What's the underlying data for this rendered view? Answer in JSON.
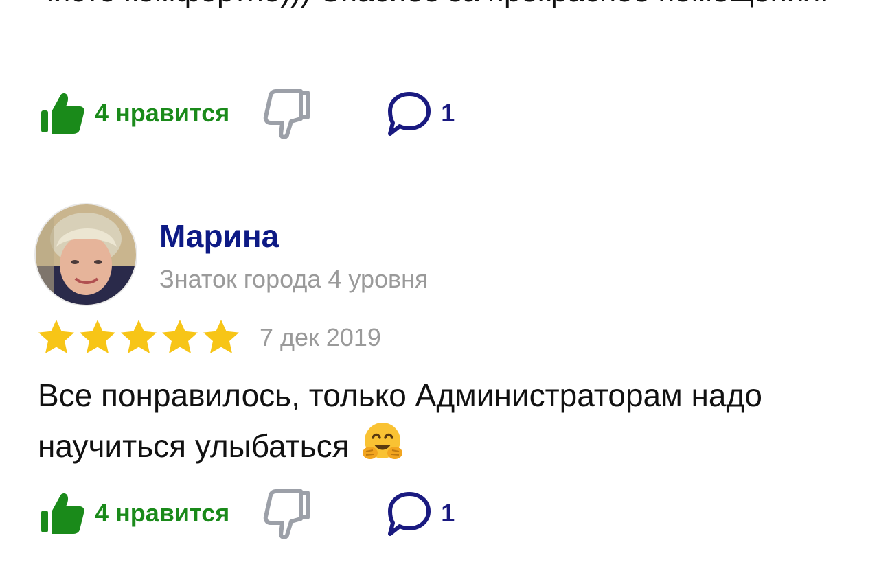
{
  "previous_review": {
    "text": "чисто комфортно))) Спасибо за прекрасное помещения."
  },
  "previous_actions": {
    "likes_label": "4 нравится",
    "comments_count": "1"
  },
  "review": {
    "author_name": "Марина",
    "author_level": "Знаток города 4 уровня",
    "rating": 5,
    "rating_max": 5,
    "date": "7 дек 2019",
    "text": "Все понравилось, только Администраторам надо научиться улыбаться",
    "emoji": "hugging-face-icon",
    "actions": {
      "likes_label": "4 нравится",
      "comments_count": "1"
    }
  },
  "colors": {
    "like_green": "#1a8a1a",
    "comment_navy": "#1a1a80",
    "author_blue": "#0d1a85",
    "muted_gray": "#9a9a9a",
    "star_gold": "#f7c517",
    "dislike_gray": "#9ca0a8"
  }
}
